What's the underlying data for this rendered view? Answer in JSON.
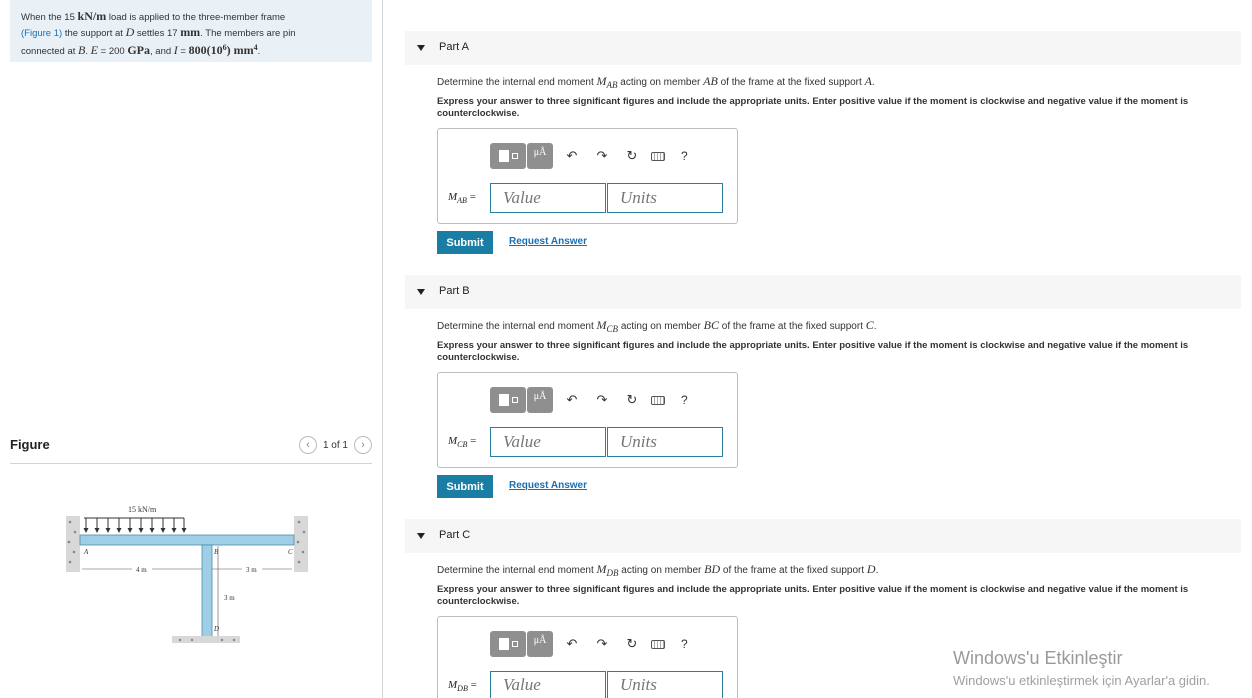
{
  "problem": {
    "t1": "When the 15 ",
    "load": "kN/m",
    "t2": " load is applied to the three-member frame",
    "figure_link": "(Figure 1)",
    "t3": " the support at ",
    "d": "D",
    "t4": " settles 17 ",
    "mm": "mm",
    "t5": ". The members are pin",
    "t6": "connected at ",
    "b": "B",
    "t7": ". ",
    "e": "E",
    "t8": " = 200 ",
    "gpa": "GPa",
    "t9": ", and ",
    "i": "I",
    "t10": " = ",
    "ival": "800(10",
    "iexp": "6",
    "ival2": ") mm",
    "iexp2": "4",
    "t11": "."
  },
  "figure": {
    "title": "Figure",
    "pager": "1 of 1",
    "load_label": "15 kN/m",
    "dim_ab": "4 m",
    "dim_bc": "3 m",
    "dim_bd": "3 m",
    "pt_a": "A",
    "pt_b": "B",
    "pt_c": "C",
    "pt_d": "D"
  },
  "parts": [
    {
      "title": "Part A",
      "q1": "Determine the internal end moment ",
      "sym": "M",
      "sub": "AB",
      "q2": " acting on member ",
      "member": "AB",
      "q3": " of the frame at the fixed support ",
      "support": "A",
      "q4": ".",
      "instr": "Express your answer to three significant figures and include the appropriate units. Enter positive value if the moment is clockwise and negative value if the moment is counterclockwise.",
      "label_sym": "M",
      "label_sub": "AB",
      "label_eq": " =",
      "value_placeholder": "Value",
      "units_placeholder": "Units",
      "submit": "Submit",
      "request": "Request Answer"
    },
    {
      "title": "Part B",
      "q1": "Determine the internal end moment ",
      "sym": "M",
      "sub": "CB",
      "q2": " acting on member ",
      "member": "BC",
      "q3": " of the frame at the fixed support ",
      "support": "C",
      "q4": ".",
      "instr": "Express your answer to three significant figures and include the appropriate units. Enter positive value if the moment is clockwise and negative value if the moment is counterclockwise.",
      "label_sym": "M",
      "label_sub": "CB",
      "label_eq": " =",
      "value_placeholder": "Value",
      "units_placeholder": "Units",
      "submit": "Submit",
      "request": "Request Answer"
    },
    {
      "title": "Part C",
      "q1": "Determine the internal end moment ",
      "sym": "M",
      "sub": "DB",
      "q2": " acting on member ",
      "member": "BD",
      "q3": " of the frame at the fixed support ",
      "support": "D",
      "q4": ".",
      "instr": "Express your answer to three significant figures and include the appropriate units. Enter positive value if the moment is clockwise and negative value if the moment is counterclockwise.",
      "label_sym": "M",
      "label_sub": "DB",
      "label_eq": " =",
      "value_placeholder": "Value",
      "units_placeholder": "Units"
    }
  ],
  "toolbar": {
    "mu_label": "μÅ",
    "help": "?"
  },
  "watermark": {
    "line1": "Windows'u Etkinleştir",
    "line2": "Windows'u etkinleştirmek için Ayarlar'a gidin."
  },
  "colors": {
    "accent": "#1a7ea4",
    "link": "#1a6fb3",
    "panel": "#e9f1f7",
    "beam": "#9fcfe6"
  }
}
